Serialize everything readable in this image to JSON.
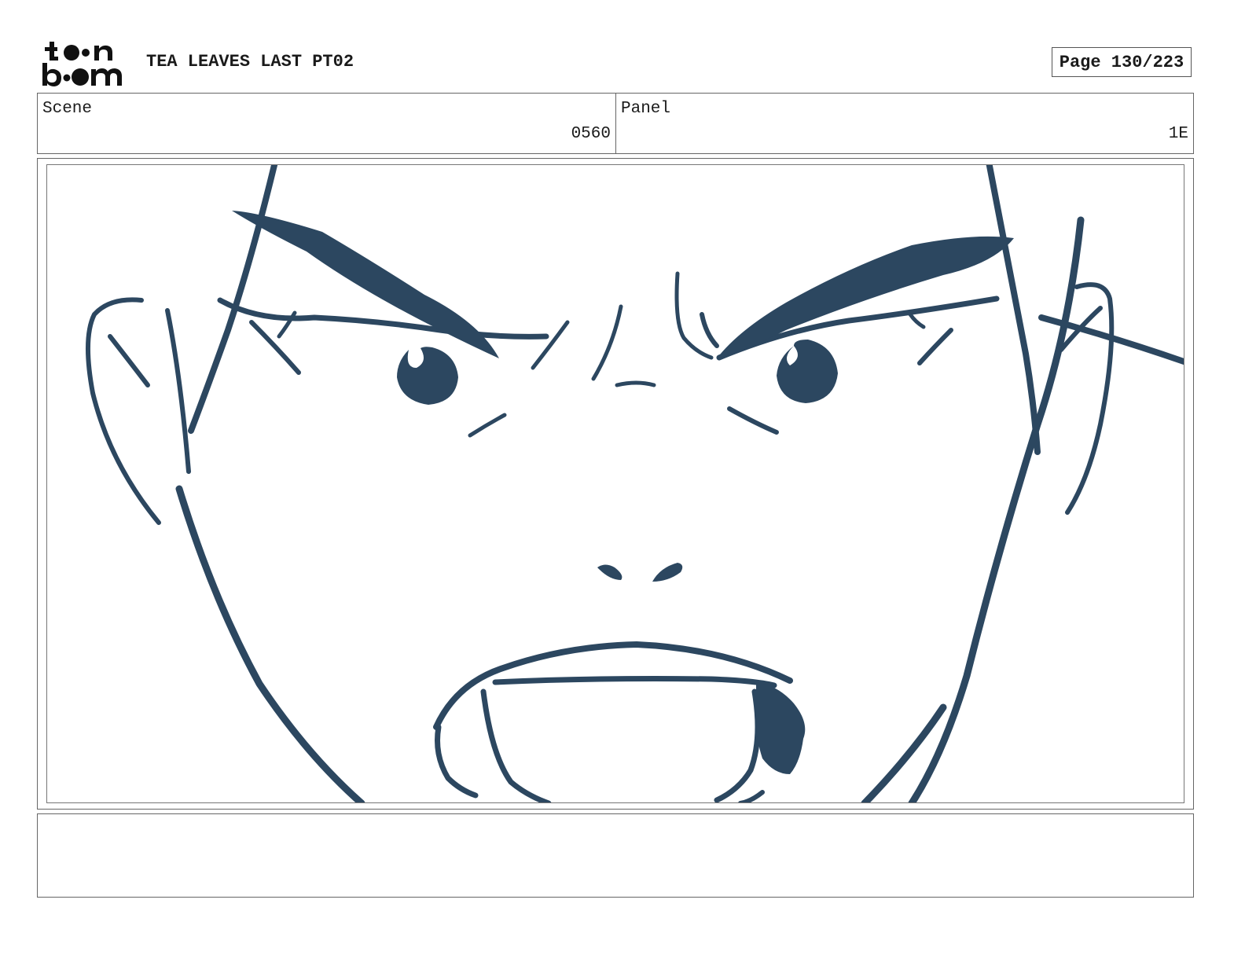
{
  "header": {
    "logo_text": "toon boom",
    "project_title": "TEA LEAVES LAST PT02",
    "page_label": "Page 130/223"
  },
  "info": {
    "scene_label": "Scene",
    "scene_value": "0560",
    "panel_label": "Panel",
    "panel_value": "1E"
  },
  "panel": {
    "content": "storyboard sketch",
    "ink_color": "#2c4760"
  },
  "caption": {
    "text": ""
  }
}
